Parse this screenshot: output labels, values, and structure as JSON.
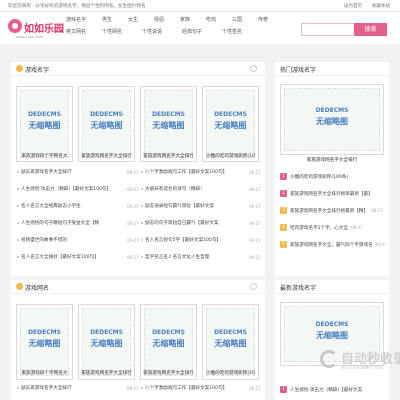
{
  "topbar": {
    "welcome": "欢迎您来到 · 分享好听的游戏名字，情侣个性的网名，女生图片网名",
    "links": [
      "设为首页",
      "收藏本站"
    ]
  },
  "logo": {
    "name": "如如乐园",
    "url": "www.xxxx.com"
  },
  "nav": {
    "row1": [
      "游戏名字",
      "男生",
      "女生",
      "情侣",
      "家族",
      "吃鸡",
      "三国",
      "传奇"
    ],
    "row2": [
      "英文网名",
      "个性网名",
      "个性说说",
      "经典句子",
      "个性签名"
    ]
  },
  "search": {
    "placeholder": "",
    "button": "搜索"
  },
  "panels": {
    "game": {
      "title": "游戏名字",
      "thumbs": [
        {
          "l1": "DEDECMS",
          "l2": "无缩略图",
          "caption": "家族游戏四个字网名大"
        },
        {
          "l1": "DEDECMS",
          "l2": "无缩略图",
          "caption": "家族游戏网名字大全排行"
        },
        {
          "l1": "DEDECMS",
          "l2": "无缩略图",
          "caption": "家族游戏网名字大全排行"
        },
        {
          "l1": "DEDECMS",
          "l2": "无缩略图",
          "caption": "沙雕的吃鸡游戏昵称(10"
        }
      ],
      "left_list": [
        {
          "text": "励志系游戏名字大全排行",
          "date": "09-27"
        },
        {
          "text": "人生感悟·攻击力（精辟)【最好文案100句】",
          "date": "09-27"
        },
        {
          "text": "名人名言大全经典励志小学生",
          "date": "09-27"
        },
        {
          "text": "人生感悟的句子精短句子受益大全【精",
          "date": "09-27"
        },
        {
          "text": "很扬盛世的故事不错的",
          "date": "09-27"
        },
        {
          "text": "名人名言大全摘抄【最好文案100句】",
          "date": "09-27"
        }
      ],
      "right_list": [
        {
          "text": "八个字激励短句工作【最好文案100句】",
          "date": "09-27"
        },
        {
          "text": "大惑局有适合的诗句（精辟）",
          "date": "09-27"
        },
        {
          "text": "励志语录短句霸气简短【最好文案",
          "date": "09-27"
        },
        {
          "text": "励志的句子简短自已霸气【最好文案",
          "date": "09-27"
        },
        {
          "text": "名人名言短句5字【最好文案100句】",
          "date": "09-27"
        },
        {
          "text": "哲学名言名人名言文化人生哲理",
          "date": "09-27"
        }
      ]
    },
    "hot": {
      "title": "热门游戏名字",
      "thumb": {
        "l1": "DEDECMS",
        "l2": "无缩略图",
        "caption": "家族游戏网名字大全排行"
      },
      "ranks": [
        {
          "num": "1",
          "text": "沙雕的吃鸡游戏昵称(100条)",
          "date": ""
        },
        {
          "num": "2",
          "text": "家族游戏网名字大全排行榜单最新【最】",
          "date": ""
        },
        {
          "num": "3",
          "text": "家族游戏网名字大全排行榜最新【精】",
          "date": "09-27"
        },
        {
          "num": "4",
          "text": "吃鸡游戏名字2个字，心大全",
          "date": "09-27"
        },
        {
          "num": "5",
          "text": "家族游戏网名字大全，霸气四个字游戏名",
          "date": "09-27"
        }
      ]
    },
    "net": {
      "title": "游戏网名",
      "thumbs": [
        {
          "l1": "DEDECMS",
          "l2": "无缩略图",
          "caption": "家族游戏四个字网名大"
        },
        {
          "l1": "DEDECMS",
          "l2": "无缩略图",
          "caption": "家族游戏网名字大全排行"
        },
        {
          "l1": "DEDECMS",
          "l2": "无缩略图",
          "caption": "家族游戏网名字大全排行"
        },
        {
          "l1": "DEDECMS",
          "l2": "无缩略图",
          "caption": "沙雕的吃鸡游戏昵称(10"
        }
      ],
      "left_list": [
        {
          "text": "励志系游戏名字大全排行",
          "date": "09-27"
        }
      ],
      "right_list": [
        {
          "text": "八个字激励短句工作【最好文案100句】",
          "date": "09-27"
        }
      ]
    },
    "latest": {
      "title": "最新游戏名字",
      "thumb": {
        "l1": "DEDECMS",
        "l2": "无缩略图",
        "caption": ""
      },
      "ranks": [
        {
          "num": "1",
          "text": "人生感悟·攻击力（精辟)【最好文案",
          "date": ""
        }
      ]
    }
  },
  "watermark": {
    "text": "自动秒收录",
    "sub": "AUTO-SUBMIT SITE"
  }
}
